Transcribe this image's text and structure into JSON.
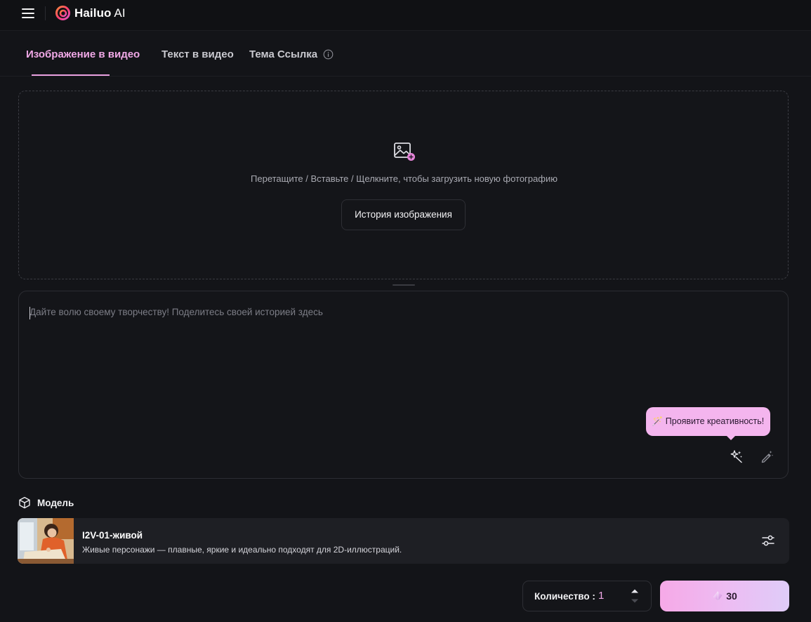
{
  "app": {
    "brand": "Hailuo",
    "brand_suffix": " AI"
  },
  "tabs": [
    {
      "label": "Изображение в видео",
      "active": true
    },
    {
      "label": "Текст в видео",
      "active": false
    },
    {
      "label": "Тема Ссылка",
      "active": false
    }
  ],
  "upload": {
    "instruction": "Перетащите / Вставьте / Щелкните, чтобы загрузить новую фотографию",
    "history_button": "История изображения"
  },
  "prompt": {
    "placeholder": "Дайте волю своему творчеству! Поделитесь своей историей здесь",
    "value": "",
    "tooltip": "🪄 Проявите креативность!"
  },
  "model": {
    "heading": "Модель",
    "name": "I2V-01-живой",
    "description": "Живые персонажи — плавные, яркие и идеально подходят для 2D-иллюстраций."
  },
  "quantity": {
    "label": "Количество :",
    "value": "1"
  },
  "generate": {
    "cost": "30"
  },
  "colors": {
    "accent": "#f0a8e6",
    "background": "#131418",
    "tooltip": "#f4b5ee"
  },
  "icons": [
    "menu-icon",
    "hailuo-logo-icon",
    "info-icon",
    "image-add-icon",
    "sparkle-wand-icon",
    "magic-pen-icon",
    "cube-icon",
    "sliders-icon",
    "chevron-up-icon",
    "chevron-down-icon",
    "gem-icon"
  ]
}
